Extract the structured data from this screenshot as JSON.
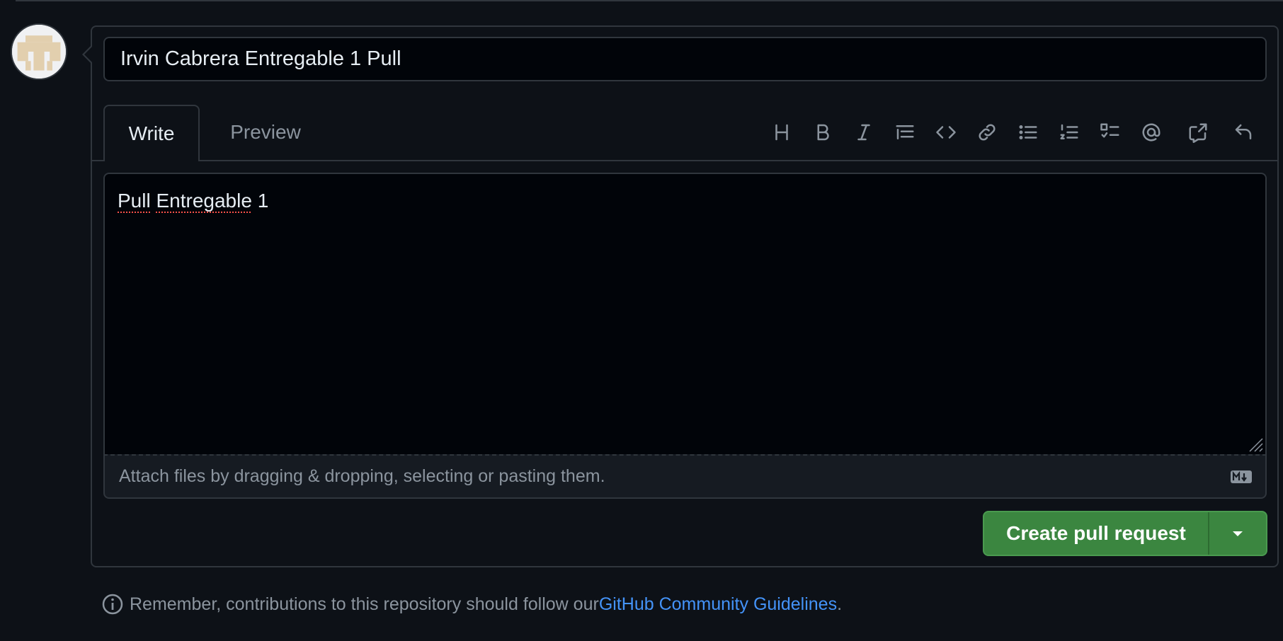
{
  "form": {
    "title_value": "Irvin Cabrera Entregable 1 Pull",
    "tabs": {
      "write": "Write",
      "preview": "Preview"
    },
    "body_value_word1": "Pull",
    "body_value_word2": "Entregable",
    "body_value_rest": " 1",
    "attach_hint": "Attach files by dragging & dropping, selecting or pasting them.",
    "submit_label": "Create pull request"
  },
  "toolbar": {
    "icons": [
      "heading-icon",
      "bold-icon",
      "italic-icon",
      "quote-icon",
      "code-icon",
      "link-icon",
      "unordered-list-icon",
      "ordered-list-icon",
      "task-list-icon",
      "mention-icon",
      "cross-reference-icon",
      "undo-icon"
    ]
  },
  "footer": {
    "text": "Remember, contributions to this repository should follow our ",
    "link": "GitHub Community Guidelines",
    "end": "."
  },
  "colors": {
    "background": "#0d1117",
    "border": "#30363d",
    "primary_button": "#3b8640",
    "link": "#4493f8",
    "muted_text": "#8b949e"
  }
}
